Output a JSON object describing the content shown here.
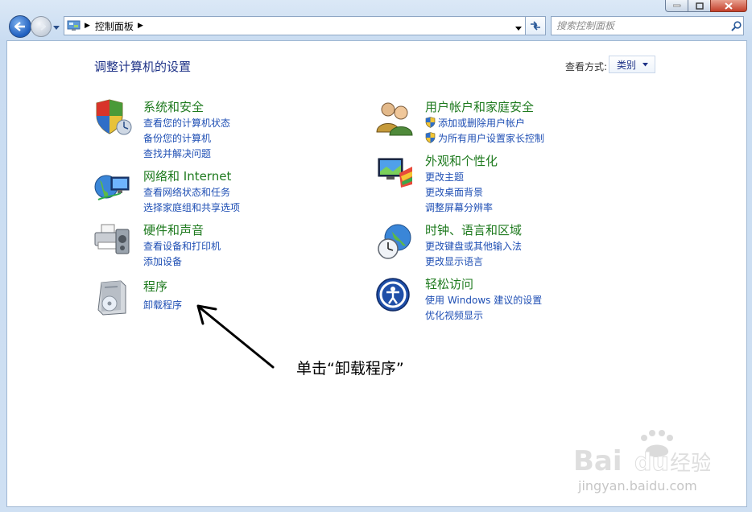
{
  "window": {
    "breadcrumb_root": "控制面板",
    "search_placeholder": "搜索控制面板"
  },
  "header": {
    "title": "调整计算机的设置",
    "view_by_label": "查看方式:",
    "view_by_value": "类别"
  },
  "categories_left": [
    {
      "title": "系统和安全",
      "links": [
        "查看您的计算机状态",
        "备份您的计算机",
        "查找并解决问题"
      ]
    },
    {
      "title": "网络和 Internet",
      "links": [
        "查看网络状态和任务",
        "选择家庭组和共享选项"
      ]
    },
    {
      "title": "硬件和声音",
      "links": [
        "查看设备和打印机",
        "添加设备"
      ]
    },
    {
      "title": "程序",
      "links": [
        "卸载程序"
      ]
    }
  ],
  "categories_right": [
    {
      "title": "用户帐户和家庭安全",
      "links": [
        "添加或删除用户帐户",
        "为所有用户设置家长控制"
      ]
    },
    {
      "title": "外观和个性化",
      "links": [
        "更改主题",
        "更改桌面背景",
        "调整屏幕分辨率"
      ]
    },
    {
      "title": "时钟、语言和区域",
      "links": [
        "更改键盘或其他输入法",
        "更改显示语言"
      ]
    },
    {
      "title": "轻松访问",
      "links": [
        "使用 Windows 建议的设置",
        "优化视频显示"
      ]
    }
  ],
  "annotation": {
    "text": "单击“卸载程序”"
  },
  "watermark": {
    "logo_text": "Baidu经验",
    "url": "jingyan.baidu.com"
  },
  "colors": {
    "category_title": "#1e7a1e",
    "link": "#1f4fb4",
    "heading": "#1e3287"
  }
}
